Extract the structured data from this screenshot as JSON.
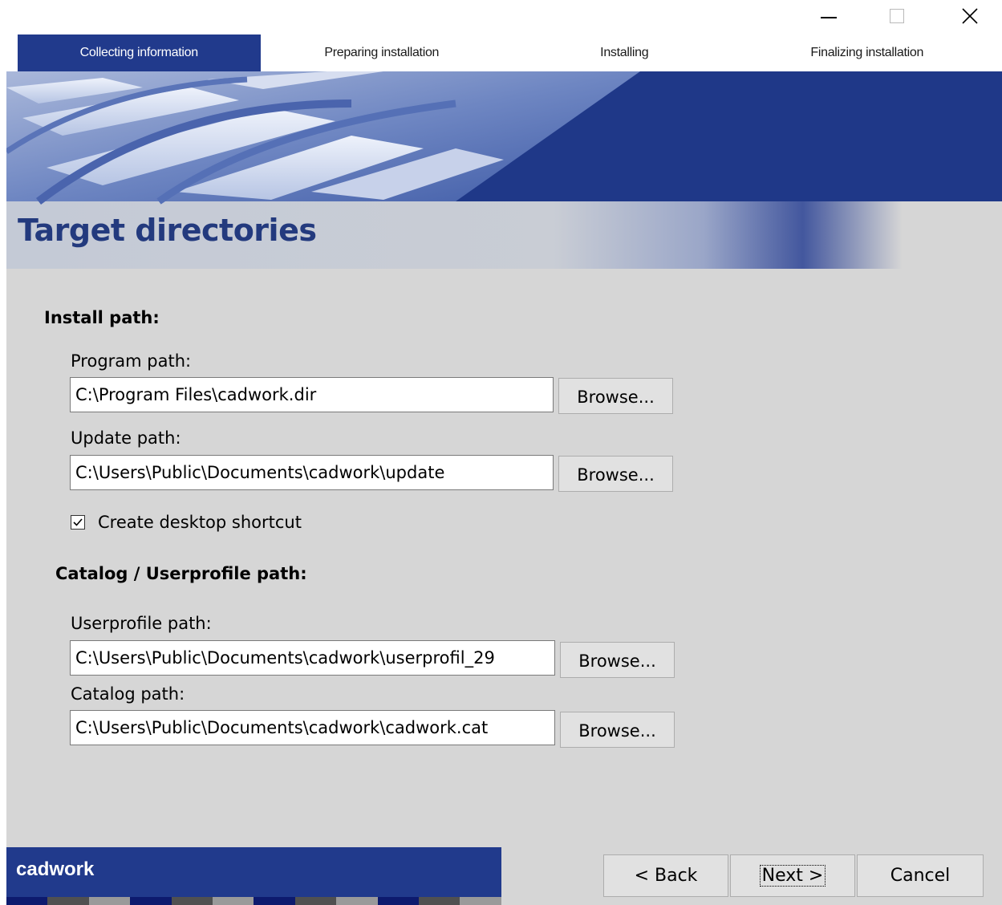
{
  "window": {
    "minimize_icon": "minimize-icon",
    "maximize_icon": "maximize-icon",
    "close_icon": "close-icon",
    "close_glyph": "✕"
  },
  "steps": [
    {
      "label": "Collecting information",
      "active": true
    },
    {
      "label": "Preparing installation",
      "active": false
    },
    {
      "label": "Installing",
      "active": false
    },
    {
      "label": "Finalizing installation",
      "active": false
    }
  ],
  "page": {
    "title": "Target directories"
  },
  "install_section": {
    "heading": "Install path:",
    "program": {
      "label": "Program path:",
      "value": "C:\\Program Files\\cadwork.dir",
      "browse": "Browse..."
    },
    "update": {
      "label": "Update path:",
      "value": "C:\\Users\\Public\\Documents\\cadwork\\update",
      "browse": "Browse..."
    },
    "shortcut": {
      "label": "Create desktop shortcut",
      "checked": true
    }
  },
  "catalog_section": {
    "heading": "Catalog / Userprofile path:",
    "userprofile": {
      "label": "Userprofile path:",
      "value": "C:\\Users\\Public\\Documents\\cadwork\\userprofil_29",
      "browse": "Browse..."
    },
    "catalog": {
      "label": "Catalog path:",
      "value": "C:\\Users\\Public\\Documents\\cadwork\\cadwork.cat",
      "browse": "Browse..."
    }
  },
  "footer": {
    "brand": "cadwork",
    "back": "< Back",
    "next": "Next >",
    "cancel": "Cancel"
  },
  "colors": {
    "accent": "#213a8c",
    "title": "#233a7e",
    "panel": "#d6d6d6",
    "strip": [
      "#0d1a6e",
      "#505050",
      "#9a9a9a"
    ]
  }
}
